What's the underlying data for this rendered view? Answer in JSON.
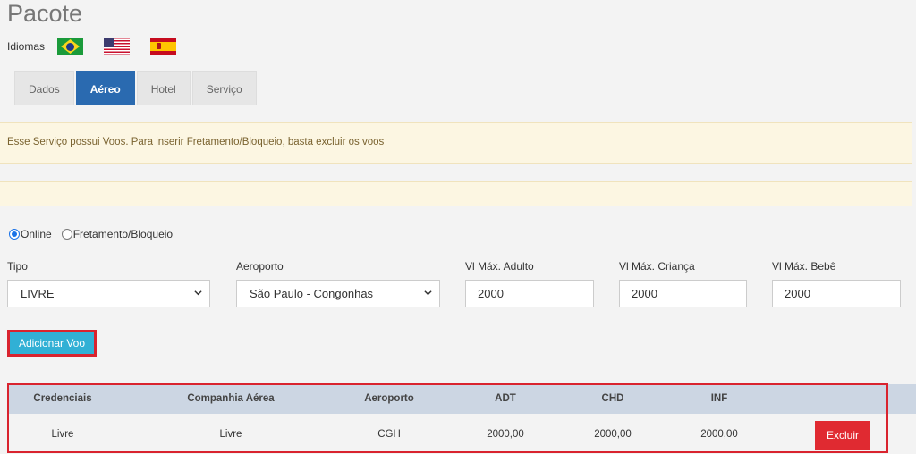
{
  "page": {
    "title": "Pacote"
  },
  "languages": {
    "label": "Idiomas",
    "flags": [
      "brazil-flag",
      "usa-flag",
      "spain-flag"
    ]
  },
  "tabs": [
    {
      "label": "Dados",
      "active": false
    },
    {
      "label": "Aéreo",
      "active": true
    },
    {
      "label": "Hotel",
      "active": false
    },
    {
      "label": "Serviço",
      "active": false
    }
  ],
  "alerts": {
    "message": "Esse Serviço possui Voos. Para inserir Fretamento/Bloqueio, basta excluir os voos",
    "empty": ""
  },
  "mode": {
    "options": [
      "Online",
      "Fretamento/Bloqueio"
    ],
    "selected": "Online"
  },
  "form": {
    "tipo": {
      "label": "Tipo",
      "value": "LIVRE"
    },
    "aeroporto": {
      "label": "Aeroporto",
      "value": "São Paulo - Congonhas"
    },
    "vl_adulto": {
      "label": "Vl Máx. Adulto",
      "value": "2000"
    },
    "vl_crianca": {
      "label": "Vl Máx. Criança",
      "value": "2000"
    },
    "vl_bebe": {
      "label": "Vl Máx. Bebê",
      "value": "2000"
    }
  },
  "add_button": {
    "label": "Adicionar Voo"
  },
  "table": {
    "headers": [
      "Credenciais",
      "Companhia Aérea",
      "Aeroporto",
      "ADT",
      "CHD",
      "INF"
    ],
    "rows": [
      {
        "credenciais": "Livre",
        "companhia": "Livre",
        "aeroporto": "CGH",
        "adt": "2000,00",
        "chd": "2000,00",
        "inf": "2000,00",
        "action": "Excluir"
      }
    ]
  },
  "colors": {
    "tab_active": "#2a6ab0",
    "button_add": "#31b0d5",
    "highlight": "#d9232e",
    "button_delete": "#e02a31",
    "alert_bg": "#fcf6e2",
    "table_header_bg": "#ccd6e3"
  }
}
